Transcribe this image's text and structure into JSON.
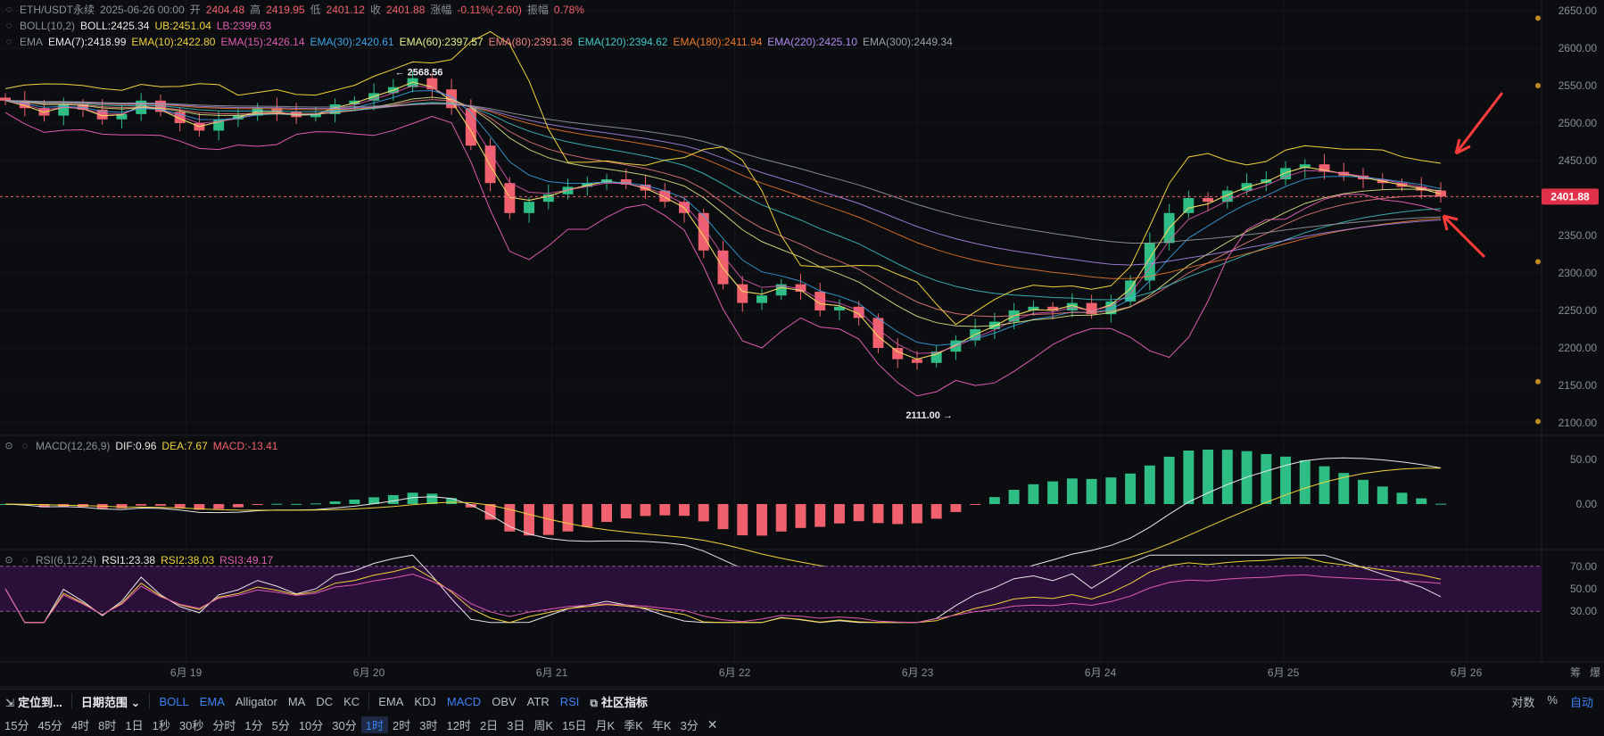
{
  "header": {
    "symbol": "ETH/USDT永续",
    "datetime": "2025-06-26 00:00",
    "open_label": "开",
    "open": "2404.48",
    "high_label": "高",
    "high": "2419.95",
    "low_label": "低",
    "low": "2401.12",
    "close_label": "收",
    "close": "2401.88",
    "change_label": "涨幅",
    "change": "-0.11%(-2.60)",
    "amp_label": "振幅",
    "amp": "0.78%"
  },
  "boll": {
    "title": "BOLL(10,2)",
    "boll": "BOLL:2425.34",
    "ub": "UB:2451.04",
    "lb": "LB:2399.63"
  },
  "ema": {
    "title": "EMA",
    "items": [
      {
        "text": "EMA(7):2418.99",
        "color": "#e8e8e8"
      },
      {
        "text": "EMA(10):2422.80",
        "color": "#f0d23c"
      },
      {
        "text": "EMA(15):2426.14",
        "color": "#e05bb0"
      },
      {
        "text": "EMA(30):2420.61",
        "color": "#3ba6e8"
      },
      {
        "text": "EMA(60):2397.57",
        "color": "#e8f08a"
      },
      {
        "text": "EMA(80):2391.36",
        "color": "#f08080"
      },
      {
        "text": "EMA(120):2394.62",
        "color": "#40c8c8"
      },
      {
        "text": "EMA(180):2411.94",
        "color": "#f07a2a"
      },
      {
        "text": "EMA(220):2425.10",
        "color": "#b08cf0"
      },
      {
        "text": "EMA(300):2449.34",
        "color": "#9aa0a8"
      }
    ]
  },
  "macd": {
    "title": "MACD(12,26,9)",
    "dif": "DIF:0.96",
    "dea": "DEA:7.67",
    "macd": "MACD:-13.41"
  },
  "rsi": {
    "title": "RSI(6,12,24)",
    "rsi1": "RSI1:23.38",
    "rsi2": "RSI2:38.03",
    "rsi3": "RSI3:49.17"
  },
  "price_axis": [
    "2650.00",
    "2600.00",
    "2550.00",
    "2500.00",
    "2450.00",
    "2400.00",
    "2350.00",
    "2300.00",
    "2250.00",
    "2200.00",
    "2150.00",
    "2100.00"
  ],
  "current_price": "2401.88",
  "macd_axis": [
    "50.00",
    "0.00"
  ],
  "rsi_axis": [
    "70.00",
    "50.00",
    "30.00"
  ],
  "x_axis": [
    "6月 19",
    "6月 20",
    "6月 21",
    "6月 22",
    "6月 23",
    "6月 24",
    "6月 25",
    "6月 26"
  ],
  "annotations": {
    "high_mark": "← 2568.56",
    "low_mark": "2111.00 →"
  },
  "toolbar1": {
    "locate": "定位到...",
    "date_range": "日期范围",
    "indicators": [
      "BOLL",
      "EMA",
      "Alligator",
      "MA",
      "DC",
      "KC"
    ],
    "sub_indicators": [
      "EMA",
      "KDJ",
      "MACD",
      "OBV",
      "ATR",
      "RSI"
    ],
    "community": "社区指标",
    "right": [
      "对数",
      "%",
      "自动"
    ]
  },
  "toolbar2": {
    "intervals": [
      "15分",
      "45分",
      "4时",
      "8时",
      "1日",
      "1秒",
      "30秒",
      "分时",
      "1分",
      "5分",
      "10分",
      "30分",
      "1时",
      "2时",
      "3时",
      "12时",
      "2日",
      "3日",
      "周K",
      "15日",
      "月K",
      "季K",
      "年K",
      "3分"
    ],
    "active": "1时"
  },
  "axis_corner": [
    "筹",
    "爆"
  ],
  "chart_data": {
    "type": "candlestick",
    "symbol": "ETH/USDT",
    "interval": "1h",
    "ylim": [
      2100,
      2650
    ],
    "close_series_approx": [
      2530,
      2520,
      2510,
      2525,
      2518,
      2505,
      2512,
      2530,
      2515,
      2500,
      2490,
      2505,
      2510,
      2520,
      2515,
      2508,
      2512,
      2525,
      2530,
      2540,
      2548,
      2560,
      2545,
      2520,
      2470,
      2420,
      2380,
      2395,
      2405,
      2415,
      2420,
      2425,
      2418,
      2410,
      2395,
      2380,
      2330,
      2285,
      2260,
      2270,
      2285,
      2275,
      2250,
      2255,
      2240,
      2200,
      2185,
      2180,
      2195,
      2210,
      2225,
      2235,
      2250,
      2255,
      2250,
      2260,
      2245,
      2262,
      2290,
      2340,
      2380,
      2400,
      2395,
      2410,
      2420,
      2425,
      2440,
      2445,
      2435,
      2430,
      2425,
      2420,
      2415,
      2410,
      2401.88
    ],
    "ema": [
      {
        "name": "EMA(7)",
        "last": 2418.99
      },
      {
        "name": "EMA(10)",
        "last": 2422.8
      },
      {
        "name": "EMA(15)",
        "last": 2426.14
      },
      {
        "name": "EMA(30)",
        "last": 2420.61
      },
      {
        "name": "EMA(60)",
        "last": 2397.57
      },
      {
        "name": "EMA(80)",
        "last": 2391.36
      },
      {
        "name": "EMA(120)",
        "last": 2394.62
      },
      {
        "name": "EMA(180)",
        "last": 2411.94
      },
      {
        "name": "EMA(220)",
        "last": 2425.1
      },
      {
        "name": "EMA(300)",
        "last": 2449.34
      }
    ],
    "boll": {
      "mid": 2425.34,
      "ub": 2451.04,
      "lb": 2399.63
    },
    "macd": {
      "dif": 0.96,
      "dea": 7.67,
      "hist": -13.41,
      "ylim": [
        -50,
        50
      ]
    },
    "rsi": {
      "rsi1": 23.38,
      "rsi2": 38.03,
      "rsi3": 49.17,
      "ylim": [
        0,
        100
      ],
      "bands": [
        30,
        70
      ]
    },
    "high": 2568.56,
    "low": 2111.0
  }
}
